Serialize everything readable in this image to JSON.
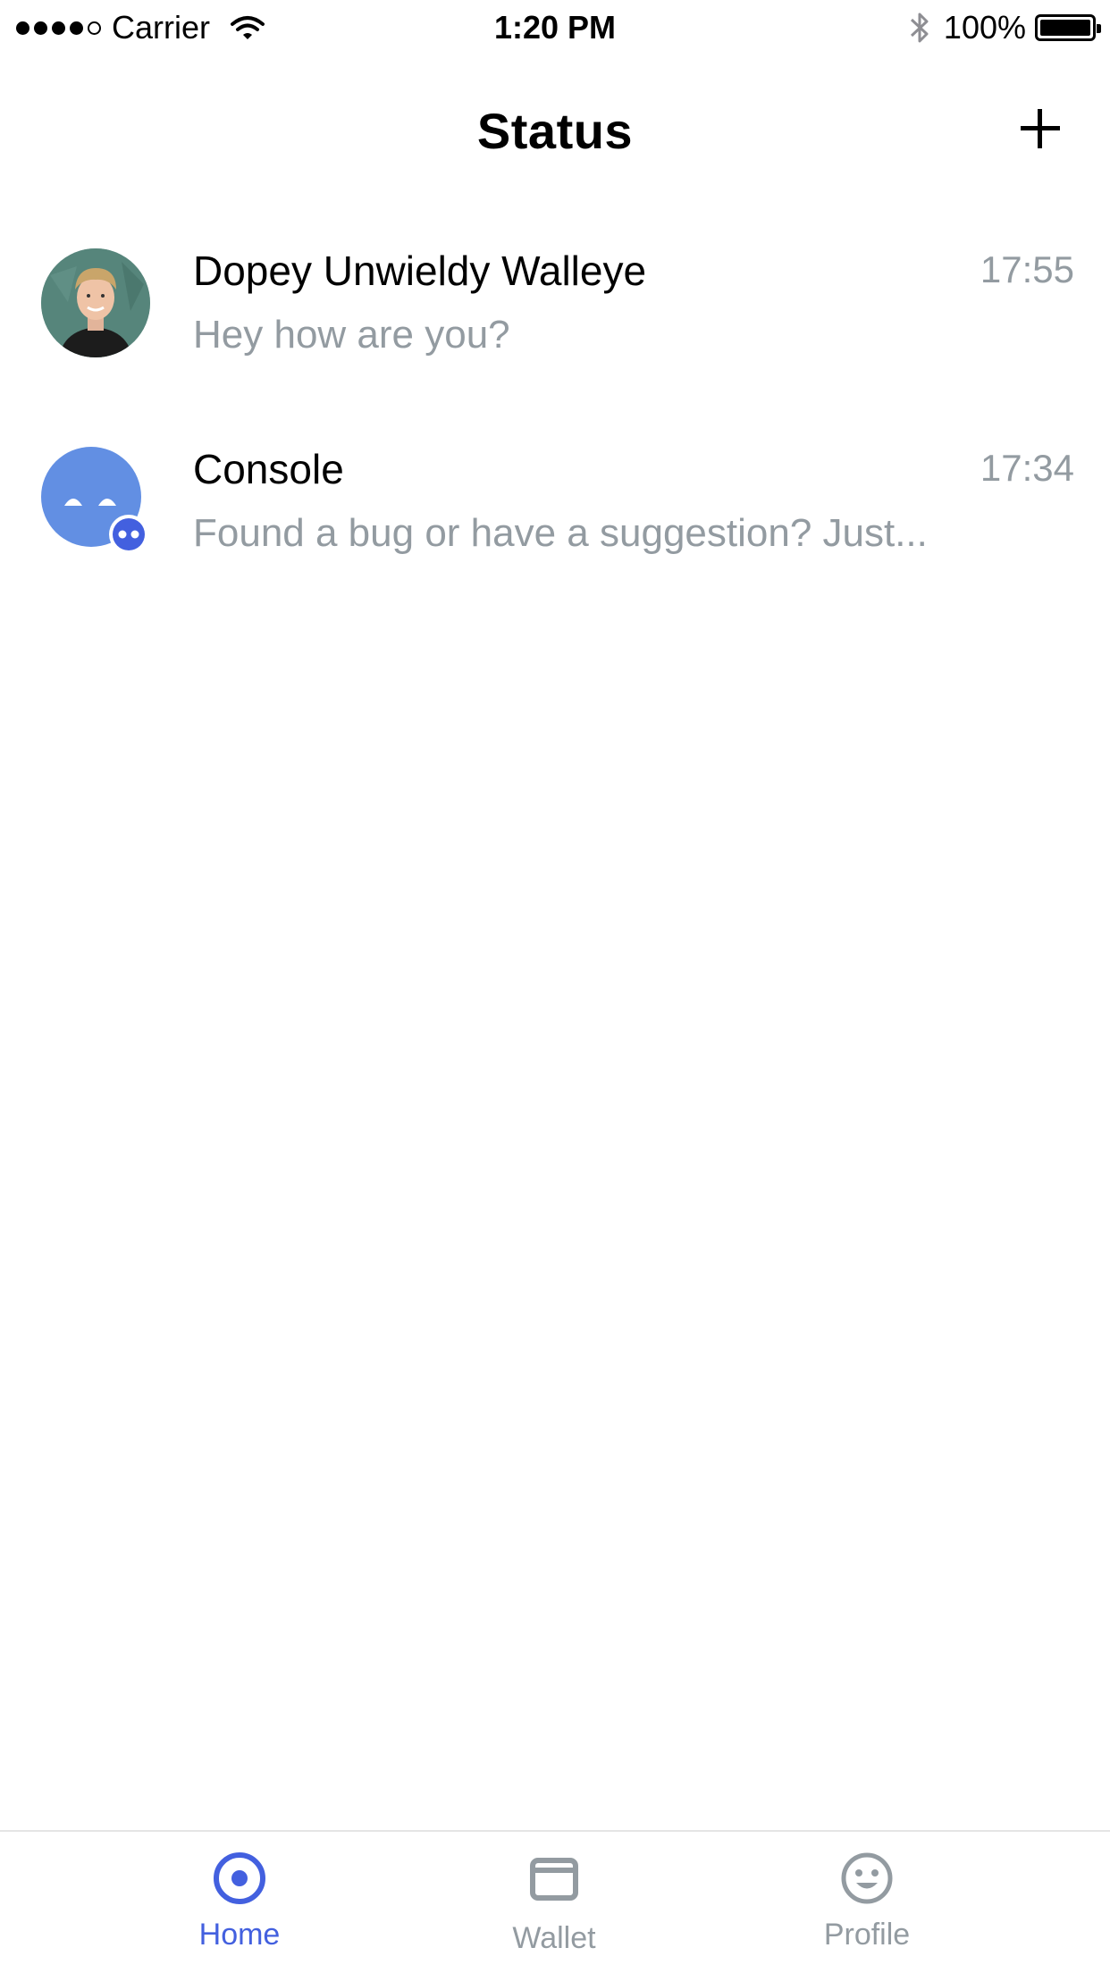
{
  "status_bar": {
    "carrier": "Carrier",
    "time": "1:20 PM",
    "battery": "100%",
    "signal_bars_filled": 4,
    "signal_bars_total": 5
  },
  "header": {
    "title": "Status",
    "add_icon": "plus-icon"
  },
  "chats": [
    {
      "name": "Dopey Unwieldy Walleye",
      "preview": "Hey how are you?",
      "time": "17:55",
      "avatar": "user-photo"
    },
    {
      "name": "Console",
      "preview": "Found a bug or have a suggestion? Just...",
      "time": "17:34",
      "avatar": "console-bot-icon"
    }
  ],
  "tabs": [
    {
      "label": "Home",
      "icon": "home-icon",
      "active": true
    },
    {
      "label": "Wallet",
      "icon": "wallet-icon",
      "active": false
    },
    {
      "label": "Profile",
      "icon": "smiley-icon",
      "active": false
    }
  ],
  "colors": {
    "accent": "#4360df",
    "secondary_text": "#939ba1",
    "console_avatar": "#628fe3"
  }
}
